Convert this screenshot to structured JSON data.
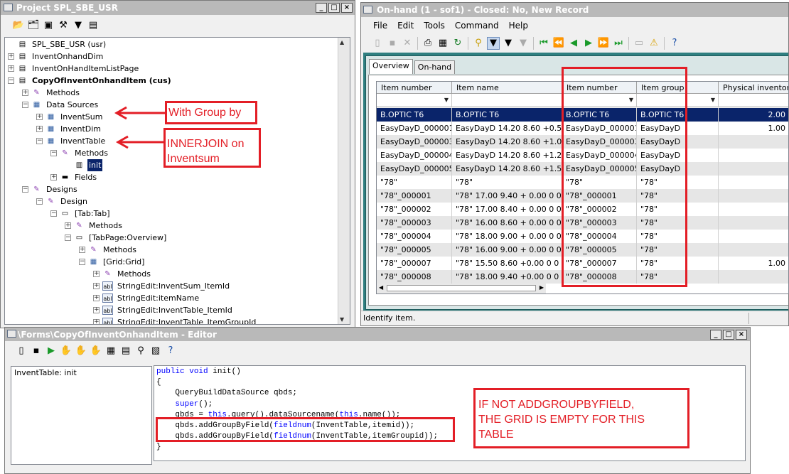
{
  "project_window": {
    "title": "Project SPL_SBE_USR",
    "tree": [
      {
        "label": "SPL_SBE_USR (usr)",
        "icon": "project-icon",
        "toggle": ""
      },
      {
        "label": "InventOnhandDim",
        "icon": "form-icon",
        "toggle": "+"
      },
      {
        "label": "InventOnHandItemListPage",
        "icon": "form-icon",
        "toggle": "+"
      },
      {
        "label": "CopyOfInventOnhandItem (cus)",
        "icon": "form-icon",
        "toggle": "−"
      },
      {
        "label": "Methods",
        "icon": "methods-icon",
        "toggle": "+"
      },
      {
        "label": "Data Sources",
        "icon": "datasource-icon",
        "toggle": "−"
      },
      {
        "label": "InventSum",
        "icon": "table-icon",
        "toggle": "+"
      },
      {
        "label": "InventDim",
        "icon": "table-icon",
        "toggle": "+"
      },
      {
        "label": "InventTable",
        "icon": "table-icon",
        "toggle": "−"
      },
      {
        "label": "Methods",
        "icon": "methods-icon",
        "toggle": "−"
      },
      {
        "label": "init",
        "icon": "method-icon",
        "toggle": ""
      },
      {
        "label": "Fields",
        "icon": "fields-icon",
        "toggle": "+"
      },
      {
        "label": "Designs",
        "icon": "designs-icon",
        "toggle": "−"
      },
      {
        "label": "Design",
        "icon": "design-icon",
        "toggle": "−"
      },
      {
        "label": "[Tab:Tab]",
        "icon": "tab-icon",
        "toggle": "−"
      },
      {
        "label": "Methods",
        "icon": "methods-icon",
        "toggle": "+"
      },
      {
        "label": "[TabPage:Overview]",
        "icon": "tabpage-icon",
        "toggle": "−"
      },
      {
        "label": "Methods",
        "icon": "methods-icon",
        "toggle": "+"
      },
      {
        "label": "[Grid:Grid]",
        "icon": "grid-icon",
        "toggle": "−"
      },
      {
        "label": "Methods",
        "icon": "methods-icon",
        "toggle": "+"
      },
      {
        "label": "StringEdit:InventSum_ItemId",
        "icon": "stringedit-icon",
        "toggle": "+"
      },
      {
        "label": "StringEdit:itemName",
        "icon": "stringedit-icon",
        "toggle": "+"
      },
      {
        "label": "StringEdit:InventTable_ItemId",
        "icon": "stringedit-icon",
        "toggle": "+"
      },
      {
        "label": "StringEdit:InventTable_ItemGroupId",
        "icon": "stringedit-icon",
        "toggle": "+"
      }
    ]
  },
  "onhand_window": {
    "title": "On-hand (1 - sof1) - Closed: No, New Record",
    "menu": [
      "File",
      "Edit",
      "Tools",
      "Command",
      "Help"
    ],
    "tabs": [
      "Overview",
      "On-hand"
    ],
    "grid": {
      "columns": [
        "Item number",
        "Item name",
        "Item number",
        "Item group",
        "Physical inventory"
      ],
      "rows": [
        [
          "B.OPTIC T6",
          "B.OPTIC T6",
          "B.OPTIC T6",
          "B.OPTIC T6",
          "2.00"
        ],
        [
          "EasyDayD_000001",
          "EasyDayD 14.20 8.60 +0.50",
          "EasyDayD_000001",
          "EasyDayD",
          "1.00"
        ],
        [
          "EasyDayD_000003",
          "EasyDayD 14.20 8.60 +1.00",
          "EasyDayD_000003",
          "EasyDayD",
          ""
        ],
        [
          "EasyDayD_000004",
          "EasyDayD 14.20 8.60 +1.25",
          "EasyDayD_000004",
          "EasyDayD",
          ""
        ],
        [
          "EasyDayD_000005",
          "EasyDayD 14.20 8.60 +1.50",
          "EasyDayD_000005",
          "EasyDayD",
          ""
        ],
        [
          "\"78\"",
          "\"78\"",
          "\"78\"",
          "\"78\"",
          ""
        ],
        [
          "\"78\"_000001",
          "\"78\" 17.00 9.40 + 0.00 0 0",
          "\"78\"_000001",
          "\"78\"",
          ""
        ],
        [
          "\"78\"_000002",
          "\"78\" 17.00 8.40 + 0.00 0 0",
          "\"78\"_000002",
          "\"78\"",
          ""
        ],
        [
          "\"78\"_000003",
          "\"78\" 16.00 8.60 + 0.00 0 0",
          "\"78\"_000003",
          "\"78\"",
          ""
        ],
        [
          "\"78\"_000004",
          "\"78\" 18.00 9.00 + 0.00 0 0",
          "\"78\"_000004",
          "\"78\"",
          ""
        ],
        [
          "\"78\"_000005",
          "\"78\" 16.00 9.00 + 0.00 0 0",
          "\"78\"_000005",
          "\"78\"",
          ""
        ],
        [
          "\"78\"_000007",
          "\"78\" 15.50 8.60 +0.00 0 0",
          "\"78\"_000007",
          "\"78\"",
          "1.00"
        ],
        [
          "\"78\"_000008",
          "\"78\" 18.00 9.40 +0.00 0 0",
          "\"78\"_000008",
          "\"78\"",
          ""
        ]
      ]
    },
    "status": "Identify item."
  },
  "editor_window": {
    "title": "\\Forms\\CopyOfInventOnhandItem - Editor",
    "method_list": [
      "InventTable: init"
    ],
    "code_lines": [
      "public void init()",
      "{",
      "    QueryBuildDataSource qbds;",
      "    super();",
      "    qbds = this.query().dataSourcename(this.name());",
      "    qbds.addGroupByField(fieldnum(InventTable,itemid));",
      "    qbds.addGroupByField(fieldnum(InventTable,itemGroupid));",
      "}"
    ]
  },
  "annotations": {
    "group_by": "With Group by",
    "innerjoin_line1": "INNERJOIN on",
    "innerjoin_line2": "Inventsum",
    "note_line1": "IF NOT ADDGROUPBYFIELD,",
    "note_line2": "THE GRID IS EMPTY FOR THIS",
    "note_line3": "TABLE"
  },
  "colors": {
    "annotation_red": "#e31e26",
    "selection_blue": "#0a246a",
    "keyword_blue": "#0000ff",
    "window_teal": "#2f7f80"
  }
}
